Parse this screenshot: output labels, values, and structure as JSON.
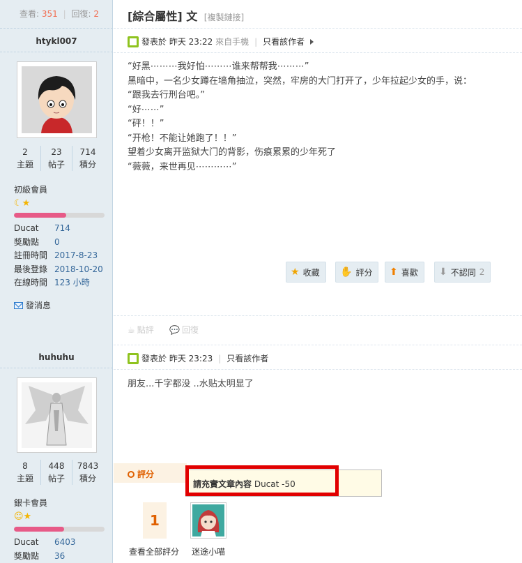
{
  "thread": {
    "views_label": "查看:",
    "views": "351",
    "replies_label": "回復:",
    "replies": "2",
    "title": "[綜合屬性] 文",
    "copy_link": "[複製鏈接]"
  },
  "post1": {
    "author": "htykl007",
    "stats": [
      {
        "value": "2",
        "label": "主題"
      },
      {
        "value": "23",
        "label": "帖子"
      },
      {
        "value": "714",
        "label": "積分"
      }
    ],
    "rank": "初級會員",
    "rank_icons": "☾★",
    "progress": 0.58,
    "info": [
      {
        "key": "Ducat",
        "value": "714"
      },
      {
        "key": "獎勵點",
        "value": "0"
      },
      {
        "key": "註冊時間",
        "value": "2017-8-23"
      },
      {
        "key": "最後登錄",
        "value": "2018-10-20"
      },
      {
        "key": "在線時間",
        "value": "123 小時"
      }
    ],
    "send_msg": "發消息",
    "posted_label": "發表於",
    "posted_time": "昨天 23:22",
    "from_mobile": "來自手機",
    "only_author": "只看該作者",
    "body": [
      "“好黑⋯⋯⋯我好怕⋯⋯⋯谁来帮帮我⋯⋯⋯”",
      "黑暗中，一名少女蹲在墙角抽泣，突然，牢房的大门打开了，少年拉起少女的手，说：",
      "“跟我去行刑台吧。”",
      "“好⋯⋯”",
      "“砰！！”",
      "“开枪！不能让她跑了！！”",
      "望着少女离开监狱大门的背影，伤痕累累的少年死了",
      "“薇薇，来世再见⋯⋯⋯⋯”"
    ],
    "actions": {
      "favorite": "收藏",
      "rate": "評分",
      "like": "喜歡",
      "dislike": "不認同",
      "dislike_count": "2"
    },
    "comment": "點評",
    "reply": "回復"
  },
  "post2": {
    "author": "huhuhu",
    "stats": [
      {
        "value": "8",
        "label": "主題"
      },
      {
        "value": "448",
        "label": "帖子"
      },
      {
        "value": "7843",
        "label": "積分"
      }
    ],
    "rank": "銀卡會員",
    "rank_icons": "☺★",
    "progress": 0.55,
    "info": [
      {
        "key": "Ducat",
        "value": "6403"
      },
      {
        "key": "獎勵點",
        "value": "36"
      }
    ],
    "posted_label": "發表於",
    "posted_time": "昨天 23:23",
    "only_author": "只看該作者",
    "body": "朋友...千字都没 ..水贴太明显了",
    "rating": {
      "title": "評分",
      "note_bold": "請充實文章內容",
      "note_rest": "Ducat -50",
      "score": "1",
      "view_all": "查看全部評分",
      "rater": "迷途小喵"
    }
  },
  "colors": {
    "sidebar_bg": "#e5edf2",
    "accent_orange": "#e06000",
    "highlight_red": "#e10000",
    "link_blue": "#336699"
  }
}
